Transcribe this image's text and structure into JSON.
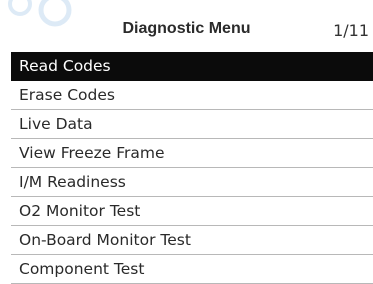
{
  "header": {
    "title": "Diagnostic Menu",
    "page_indicator": "1/11"
  },
  "menu": {
    "selected_index": 0,
    "items": [
      {
        "label": "Read Codes"
      },
      {
        "label": "Erase Codes"
      },
      {
        "label": "Live Data"
      },
      {
        "label": "View Freeze Frame"
      },
      {
        "label": "I/M Readiness"
      },
      {
        "label": "O2 Monitor Test"
      },
      {
        "label": "On-Board Monitor Test"
      },
      {
        "label": "Component Test"
      }
    ]
  },
  "colors": {
    "selected_bg": "#0b0b0b",
    "selected_text": "#ffffff",
    "item_text": "#2a2a2a",
    "divider": "#b8b8b8"
  }
}
